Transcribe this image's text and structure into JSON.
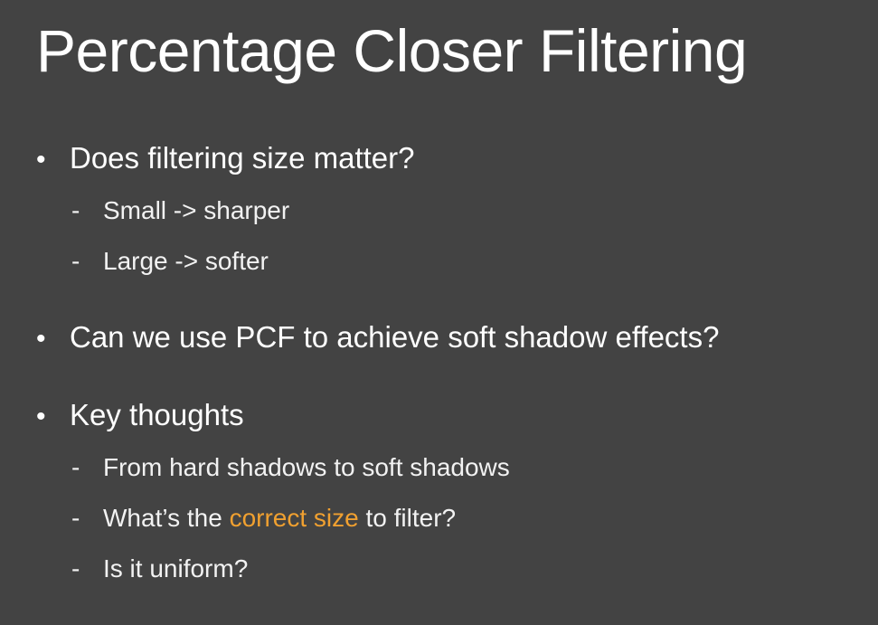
{
  "slide": {
    "title": "Percentage Closer Filtering",
    "accent_color": "#f0a030",
    "background_color": "#434343",
    "bullets": [
      {
        "marker": "•",
        "text": "Does filtering size matter?",
        "subitems": [
          {
            "marker": "-",
            "text": "Small -> sharper"
          },
          {
            "marker": "-",
            "text": "Large -> softer"
          }
        ]
      },
      {
        "marker": "•",
        "text": "Can we use PCF to achieve soft shadow effects?"
      },
      {
        "marker": "•",
        "text": "Key thoughts",
        "subitems": [
          {
            "marker": "-",
            "text": "From hard shadows to soft shadows"
          },
          {
            "marker": "-",
            "text_before": "What’s the ",
            "text_highlight": "correct size",
            "text_after": " to filter?"
          },
          {
            "marker": "-",
            "text": "Is it uniform?"
          }
        ]
      }
    ]
  }
}
